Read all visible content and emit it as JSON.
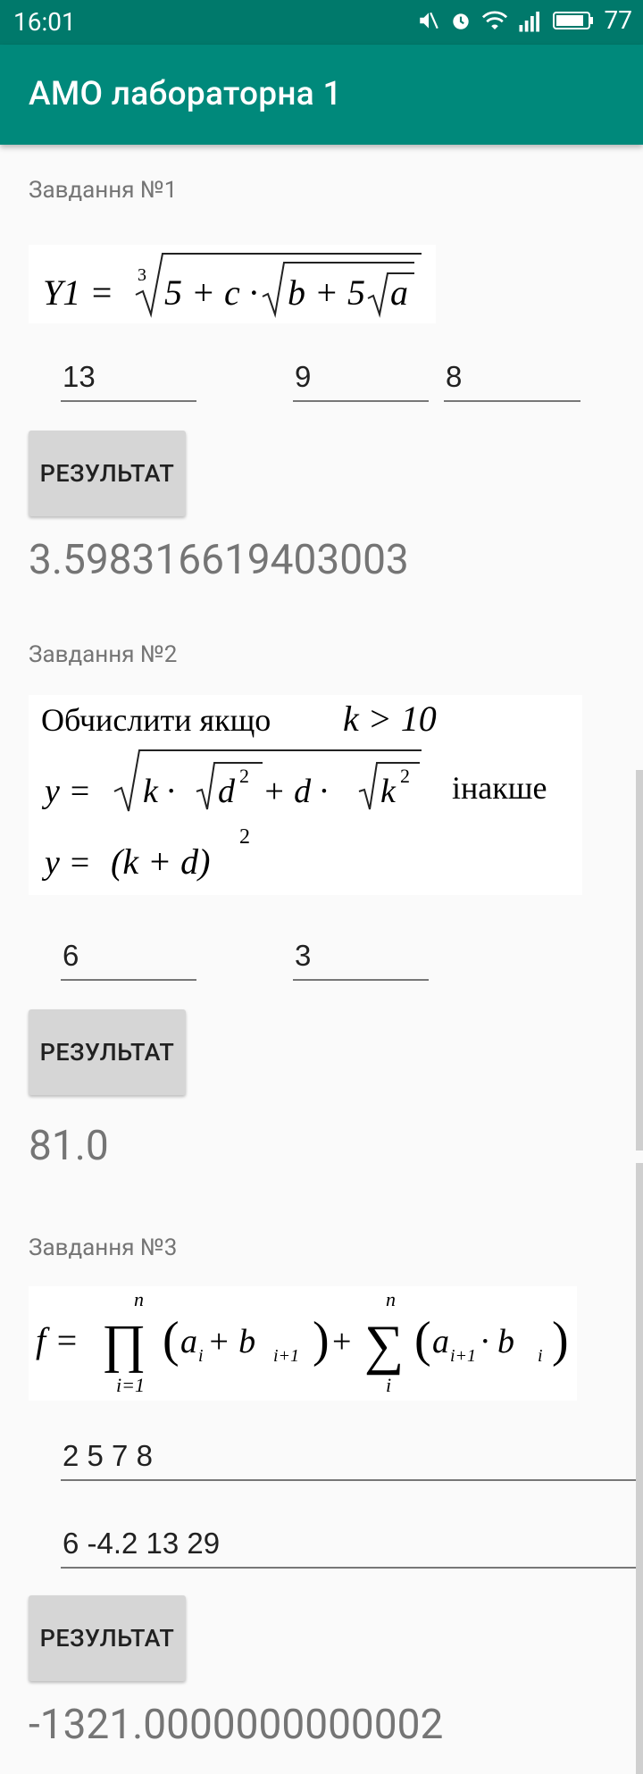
{
  "status_bar": {
    "time": "16:01",
    "battery": "77",
    "icons": [
      "mute-icon",
      "alarm-icon",
      "wifi-icon",
      "signal-icon",
      "battery-icon"
    ]
  },
  "app_bar": {
    "title": "АМО лабораторна 1"
  },
  "colors": {
    "primary": "#00897b",
    "primary_dark": "#00796b",
    "button": "#d6d6d6"
  },
  "tasks": [
    {
      "label": "Завдання №1",
      "formula": {
        "lhs": "Y1 =",
        "root_index": "3",
        "part1": "5 + c · ",
        "part2": "b + 5",
        "var_a": "a"
      },
      "inputs": [
        "13",
        "9",
        "8"
      ],
      "button_label": "РЕЗУЛЬТАТ",
      "result": "3.598316619403003"
    },
    {
      "label": "Завдання №2",
      "formula": {
        "line1_text": "Обчислити якщо",
        "condition": "k > 10",
        "y_eq": "y =",
        "k_dot": "k · ",
        "d": "d",
        "exp2": "2",
        "plus_d_dot": " + d · ",
        "k": "k",
        "otherwise": "інакше",
        "y_eq2": "y =",
        "paren_expr": "(k + d)",
        "exp2b": "2"
      },
      "inputs": [
        "6",
        "3"
      ],
      "button_label": "РЕЗУЛЬТАТ",
      "result": "81.0"
    },
    {
      "label": "Завдання №3",
      "formula": {
        "f_eq": "f =",
        "prod_sym": "∏",
        "prod_upper": "n",
        "prod_lower": "i=1",
        "a": "a",
        "sub_i": "i",
        "plus_b": " + b",
        "sub_i1": "i+1",
        "plus": "+",
        "sum_sym": "∑",
        "sum_upper": "n",
        "sum_lower": "i",
        "a2": "a",
        "sub_i1b": "i+1",
        "dot_b": " · b",
        "sub_ib": "i"
      },
      "inputs": [
        "2 5 7 8",
        "6 -4.2 13 29"
      ],
      "button_label": "РЕЗУЛЬТАТ",
      "result": "-1321.0000000000002"
    }
  ]
}
